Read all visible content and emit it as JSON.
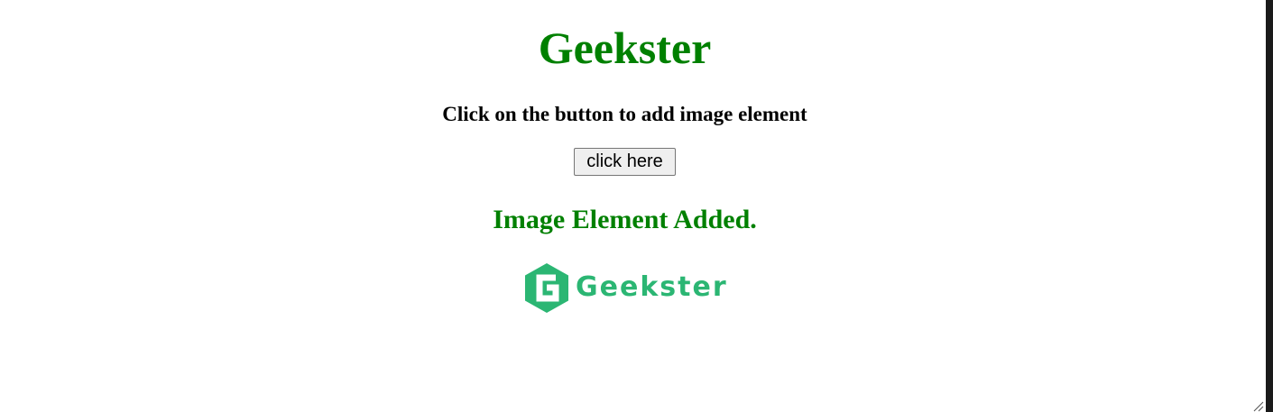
{
  "page": {
    "title": "Geekster",
    "instruction": "Click on the button to add image element",
    "button_label": "click here",
    "status_message": "Image Element Added."
  },
  "image": {
    "logo_text": "Geekster",
    "brand_color": "#2bb673"
  },
  "colors": {
    "heading": "#008000",
    "text": "#000000",
    "button_bg": "#efefef"
  }
}
